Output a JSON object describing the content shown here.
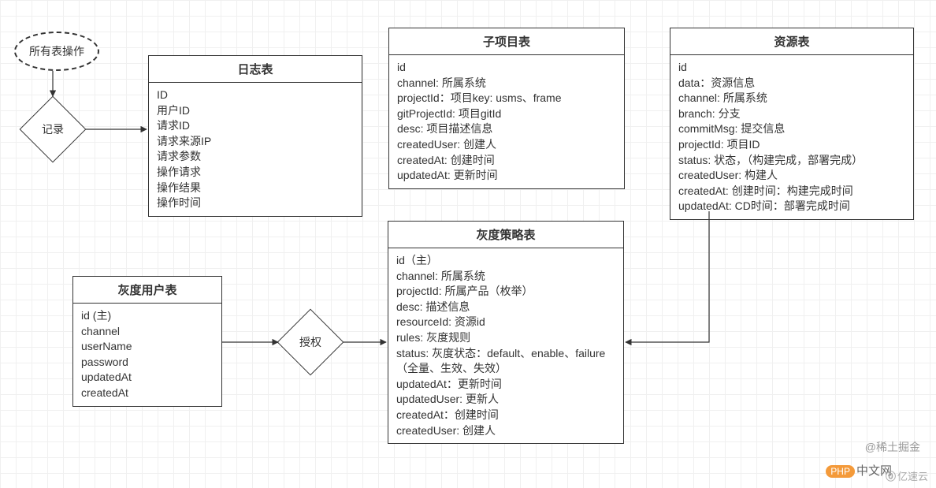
{
  "startNode": {
    "label": "所有表操作"
  },
  "recordNode": {
    "label": "记录"
  },
  "authNode": {
    "label": "授权"
  },
  "logTable": {
    "title": "日志表",
    "fields": [
      "ID",
      "用户ID",
      "请求ID",
      "请求来源IP",
      "请求参数",
      "操作请求",
      "操作结果",
      "操作时间"
    ]
  },
  "subProjectTable": {
    "title": "子项目表",
    "fields": [
      "id",
      "channel: 所属系统",
      "projectId：项目key: usms、frame",
      "gitProjectId: 项目gitId",
      "desc: 项目描述信息",
      "createdUser: 创建人",
      "createdAt: 创建时间",
      "updatedAt: 更新时间"
    ]
  },
  "resourceTable": {
    "title": "资源表",
    "fields": [
      "id",
      "data：资源信息",
      "channel: 所属系统",
      "branch: 分支",
      "commitMsg: 提交信息",
      "projectId: 项目ID",
      "status: 状态，（构建完成，部署完成）",
      "createdUser: 构建人",
      "createdAt: 创建时间：构建完成时间",
      "updatedAt: CD时间：部署完成时间"
    ]
  },
  "grayUserTable": {
    "title": "灰度用户表",
    "fields": [
      "id (主)",
      "channel",
      "userName",
      "password",
      "updatedAt",
      "createdAt"
    ]
  },
  "grayStrategyTable": {
    "title": "灰度策略表",
    "fields": [
      "id（主）",
      "channel: 所属系统",
      "projectId: 所属产品（枚举）",
      "desc: 描述信息",
      "resourceId: 资源id",
      "rules: 灰度规则",
      "status: 灰度状态：default、enable、failure（全量、生效、失效）",
      "updatedAt：更新时间",
      "updatedUser: 更新人",
      "createdAt：创建时间",
      "createdUser: 创建人"
    ]
  },
  "watermark": {
    "xitu": "@稀土掘金",
    "phpBadge": "PHP",
    "phpText": "中文网",
    "yisu": "亿速云",
    "yisuIcon": "⓪"
  }
}
